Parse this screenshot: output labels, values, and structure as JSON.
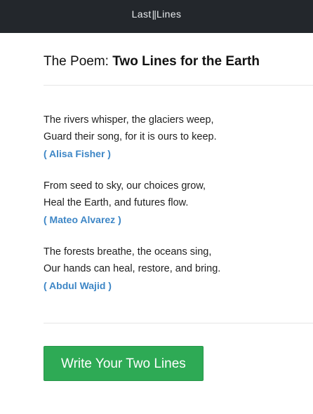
{
  "header": {
    "brand_left": "Last",
    "brand_sep": "||",
    "brand_right": "Lines"
  },
  "page": {
    "title_prefix": "The Poem: ",
    "title_bold": "Two Lines for the Earth"
  },
  "poem": {
    "stanzas": [
      {
        "line1": "The rivers whisper, the glaciers weep,",
        "line2": "Guard their song, for it is ours to keep.",
        "author": "( Alisa Fisher )"
      },
      {
        "line1": "From seed to sky, our choices grow,",
        "line2": "Heal the Earth, and futures flow.",
        "author": "( Mateo Alvarez )"
      },
      {
        "line1": "The forests breathe, the oceans sing,",
        "line2": "Our hands can heal, restore, and bring.",
        "author": "( Abdul Wajid )"
      }
    ]
  },
  "actions": {
    "write_button_label": "Write Your Two Lines"
  },
  "colors": {
    "topbar": "#23272c",
    "author_link": "#3d86c6",
    "cta_green": "#2eaa55"
  }
}
